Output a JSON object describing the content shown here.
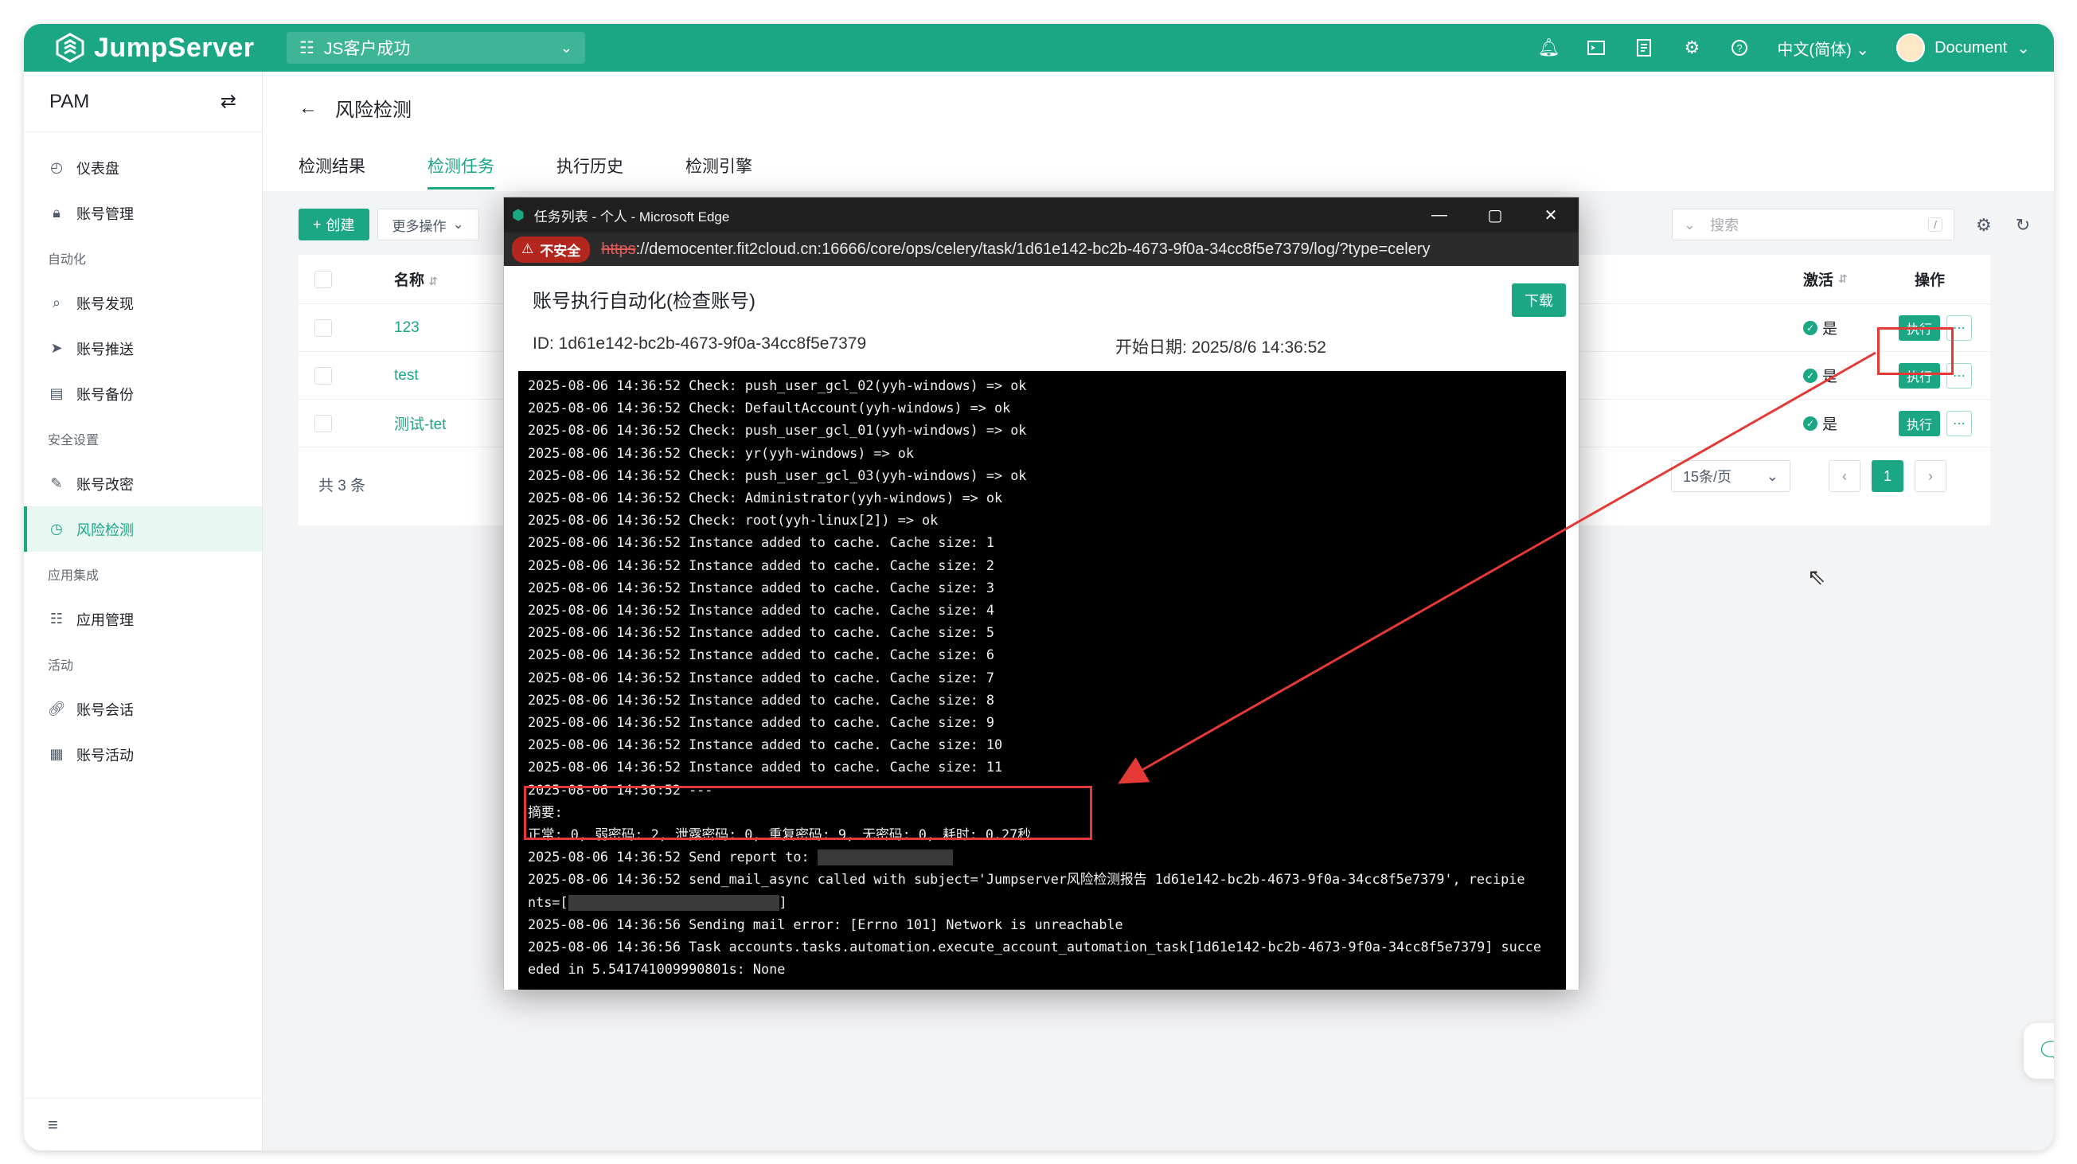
{
  "app": {
    "brand": "JumpServer",
    "org": "JS客户成功",
    "lang": "中文(简体)",
    "user": "Document"
  },
  "sidebar": {
    "title": "PAM",
    "items": [
      {
        "label": "仪表盘",
        "icon": "dashboard-icon"
      },
      {
        "label": "账号管理",
        "icon": "lock-icon"
      }
    ],
    "groups": [
      {
        "label": "自动化",
        "items": [
          "账号发现",
          "账号推送",
          "账号备份"
        ]
      },
      {
        "label": "安全设置",
        "items": [
          "账号改密",
          "风险检测"
        ]
      },
      {
        "label": "应用集成",
        "items": [
          "应用管理"
        ]
      },
      {
        "label": "活动",
        "items": [
          "账号会话",
          "账号活动"
        ]
      }
    ],
    "active": "风险检测"
  },
  "page": {
    "title": "风险检测",
    "tabs": [
      "检测结果",
      "检测任务",
      "执行历史",
      "检测引擎"
    ],
    "active_tab": "检测任务"
  },
  "toolbar": {
    "create_label": "创建",
    "more_label": "更多操作",
    "search_placeholder": "搜索",
    "search_shortcut": "/"
  },
  "table": {
    "columns": {
      "name": "名称",
      "active": "激活",
      "ops": "操作"
    },
    "rows": [
      {
        "name": "123",
        "active": "是",
        "exec": "执行"
      },
      {
        "name": "test",
        "active": "是",
        "exec": "执行"
      },
      {
        "name": "测试-tet",
        "active": "是",
        "exec": "执行"
      }
    ],
    "total": "共 3 条",
    "page_size": "15条/页",
    "current_page": "1"
  },
  "popup": {
    "window_title": "任务列表 - 个人 - Microsoft Edge",
    "insecure_label": "不安全",
    "url_scheme": "https",
    "url_rest": "://democenter.fit2cloud.cn:16666/core/ops/celery/task/1d61e142-bc2b-4673-9f0a-34cc8f5e7379/log/?type=celery",
    "task_title": "账号执行自动化(检查账号)",
    "download_label": "下载",
    "id_text": "ID: 1d61e142-bc2b-4673-9f0a-34cc8f5e7379",
    "date_text": "开始日期: 2025/8/6 14:36:52",
    "log_lines": [
      "2025-08-06 14:36:52 Check: push_user_gcl_02(yyh-windows) => ok",
      "2025-08-06 14:36:52 Check: DefaultAccount(yyh-windows) => ok",
      "2025-08-06 14:36:52 Check: push_user_gcl_01(yyh-windows) => ok",
      "2025-08-06 14:36:52 Check: yr(yyh-windows) => ok",
      "2025-08-06 14:36:52 Check: push_user_gcl_03(yyh-windows) => ok",
      "2025-08-06 14:36:52 Check: Administrator(yyh-windows) => ok",
      "2025-08-06 14:36:52 Check: root(yyh-linux[2]) => ok",
      "2025-08-06 14:36:52 Instance added to cache. Cache size: 1",
      "2025-08-06 14:36:52 Instance added to cache. Cache size: 2",
      "2025-08-06 14:36:52 Instance added to cache. Cache size: 3",
      "2025-08-06 14:36:52 Instance added to cache. Cache size: 4",
      "2025-08-06 14:36:52 Instance added to cache. Cache size: 5",
      "2025-08-06 14:36:52 Instance added to cache. Cache size: 6",
      "2025-08-06 14:36:52 Instance added to cache. Cache size: 7",
      "2025-08-06 14:36:52 Instance added to cache. Cache size: 8",
      "2025-08-06 14:36:52 Instance added to cache. Cache size: 9",
      "2025-08-06 14:36:52 Instance added to cache. Cache size: 10",
      "2025-08-06 14:36:52 Instance added to cache. Cache size: 11",
      "2025-08-06 14:36:52 ---",
      "摘要:",
      "正常: 0, 弱密码: 2, 泄露密码: 0, 重复密码: 9, 无密码: 0, 耗时: 0.27秒"
    ],
    "log_send_report": "2025-08-06 14:36:52 Send report to: ",
    "log_send_mail_1": "2025-08-06 14:36:52 send_mail_async called with subject='Jumpserver风险检测报告 1d61e142-bc2b-4673-9f0a-34cc8f5e7379', recipie",
    "log_send_mail_2_prefix": "nts=[",
    "log_send_mail_2_suffix": "]",
    "log_tail": [
      "2025-08-06 14:36:56 Sending mail error: [Errno 101] Network is unreachable",
      "2025-08-06 14:36:56 Task accounts.tasks.automation.execute_account_automation_task[1d61e142-bc2b-4673-9f0a-34cc8f5e7379] succe",
      "eded in 5.541741009990801s: None"
    ]
  },
  "colors": {
    "brand": "#1ba784",
    "annotation": "#e53935"
  }
}
